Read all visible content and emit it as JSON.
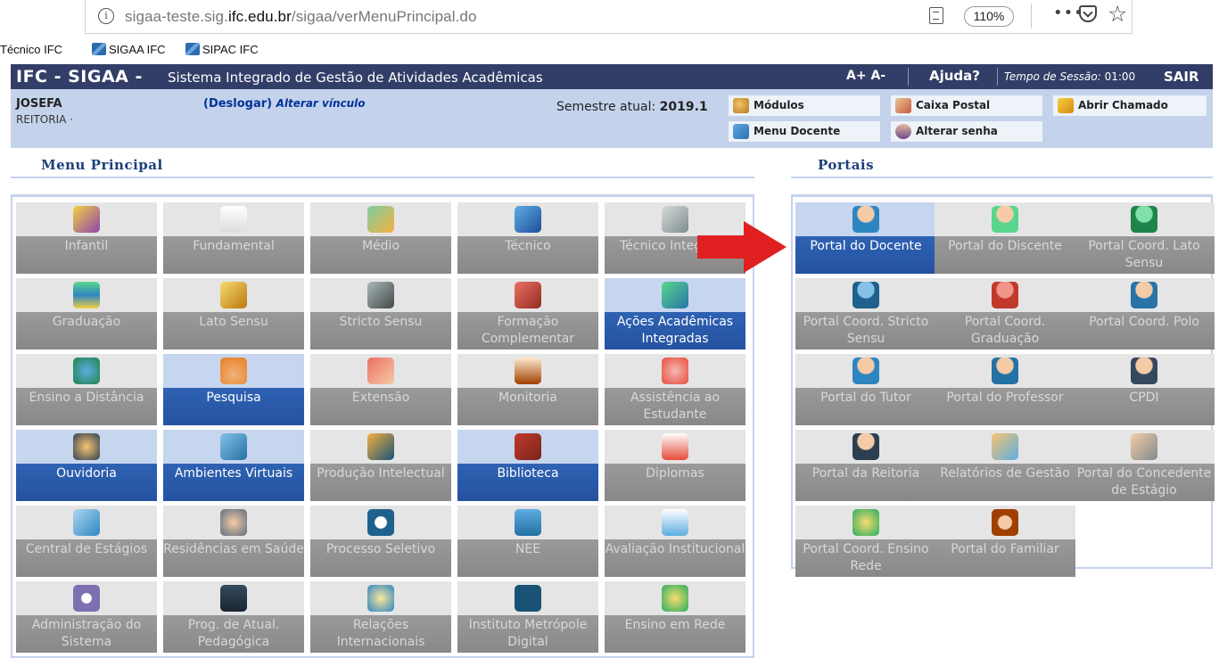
{
  "browser": {
    "url_prefix": "sigaa-teste.sig.",
    "url_domain": "ifc.edu.br",
    "url_path": "/sigaa/verMenuPrincipal.do",
    "zoom": "110%",
    "more": "•••",
    "bookmarks": [
      "Técnico IFC",
      "SIGAA IFC",
      "SIPAC IFC"
    ]
  },
  "header": {
    "system_short": "IFC - SIGAA -",
    "system_name": "Sistema Integrado de Gestão de Atividades Acadêmicas",
    "font_size": "A+ A-",
    "help": "Ajuda?",
    "session_label": "Tempo de Sessão:",
    "session_time": "01:00",
    "logout": "SAIR"
  },
  "user": {
    "name": "JOSEFA",
    "unit": "REITORIA ·",
    "logout_label": "(Deslogar)",
    "change_link": "Alterar vínculo",
    "semester_label": "Semestre atual:",
    "semester": "2019.1"
  },
  "quick_links": [
    "Módulos",
    "Caixa Postal",
    "Abrir Chamado",
    "Menu Docente",
    "Alterar senha"
  ],
  "menu_title": "Menu Principal",
  "portals_title": "Portais",
  "menu": [
    {
      "label": "Infantil",
      "active": false,
      "icon": "pencils-icon"
    },
    {
      "label": "Fundamental",
      "active": false,
      "icon": "notebook-icon"
    },
    {
      "label": "Médio",
      "active": false,
      "icon": "pencil-icon"
    },
    {
      "label": "Técnico",
      "active": false,
      "icon": "blue-book-icon"
    },
    {
      "label": "Técnico Integrado",
      "active": false,
      "icon": "drawing-icon"
    },
    {
      "label": "Graduação",
      "active": false,
      "icon": "books-stack-icon"
    },
    {
      "label": "Lato Sensu",
      "active": false,
      "icon": "folder-book-icon"
    },
    {
      "label": "Stricto Sensu",
      "active": false,
      "icon": "briefcase-icon"
    },
    {
      "label": "Formação Complementar",
      "active": false,
      "icon": "red-book-icon"
    },
    {
      "label": "Ações Acadêmicas Integradas",
      "active": true,
      "icon": "puzzle-icon"
    },
    {
      "label": "Ensino a Distância",
      "active": false,
      "icon": "globe-icon"
    },
    {
      "label": "Pesquisa",
      "active": true,
      "icon": "flask-icon"
    },
    {
      "label": "Extensão",
      "active": false,
      "icon": "house-icon"
    },
    {
      "label": "Monitoria",
      "active": false,
      "icon": "board-icon"
    },
    {
      "label": "Assistência ao Estudante",
      "active": false,
      "icon": "student-support-icon"
    },
    {
      "label": "Ouvidoria",
      "active": true,
      "icon": "headset-icon"
    },
    {
      "label": "Ambientes Virtuais",
      "active": true,
      "icon": "people-network-icon"
    },
    {
      "label": "Produção Intelectual",
      "active": false,
      "icon": "person-check-icon"
    },
    {
      "label": "Biblioteca",
      "active": true,
      "icon": "open-book-icon"
    },
    {
      "label": "Diplomas",
      "active": false,
      "icon": "certificate-icon"
    },
    {
      "label": "Central de Estágios",
      "active": false,
      "icon": "contacts-icon"
    },
    {
      "label": "Residências em Saúde",
      "active": false,
      "icon": "doctor-icon"
    },
    {
      "label": "Processo Seletivo",
      "active": false,
      "icon": "spiral-icon"
    },
    {
      "label": "NEE",
      "active": false,
      "icon": "accessibility-icon"
    },
    {
      "label": "Avaliação Institucional",
      "active": false,
      "icon": "checklist-icon"
    },
    {
      "label": "Administração do Sistema",
      "active": false,
      "icon": "gear-icon"
    },
    {
      "label": "Prog. de Atual. Pedagógica",
      "active": false,
      "icon": "monitor-icon"
    },
    {
      "label": "Relações Internacionais",
      "active": false,
      "icon": "world-map-icon"
    },
    {
      "label": "Instituto Metrópole Digital",
      "active": false,
      "icon": "imd-logo-icon"
    },
    {
      "label": "Ensino em Rede",
      "active": false,
      "icon": "network-at-icon"
    }
  ],
  "portals": [
    {
      "label": "Portal do Docente",
      "active": true,
      "icon": "teacher-icon"
    },
    {
      "label": "Portal do Discente",
      "active": false,
      "icon": "student-icon"
    },
    {
      "label": "Portal Coord. Lato Sensu",
      "active": false,
      "icon": "green-user-icon"
    },
    {
      "label": "Portal Coord. Stricto Sensu",
      "active": false,
      "icon": "blue-user-icon"
    },
    {
      "label": "Portal Coord. Graduação",
      "active": false,
      "icon": "red-user-icon"
    },
    {
      "label": "Portal Coord. Polo",
      "active": false,
      "icon": "coordinator-icon"
    },
    {
      "label": "Portal do Tutor",
      "active": false,
      "icon": "tutor-icon"
    },
    {
      "label": "Portal do Professor",
      "active": false,
      "icon": "professor-icon"
    },
    {
      "label": "CPDI",
      "active": false,
      "icon": "manager-icon"
    },
    {
      "label": "Portal da Reitoria",
      "active": false,
      "icon": "rector-icon"
    },
    {
      "label": "Relatórios de Gestão",
      "active": false,
      "icon": "report-icon"
    },
    {
      "label": "Portal do Concedente de Estágio",
      "active": false,
      "icon": "id-card-icon"
    },
    {
      "label": "Portal Coord. Ensino Rede",
      "active": false,
      "icon": "network-at-icon"
    },
    {
      "label": "Portal do Familiar",
      "active": false,
      "icon": "family-icon"
    }
  ]
}
